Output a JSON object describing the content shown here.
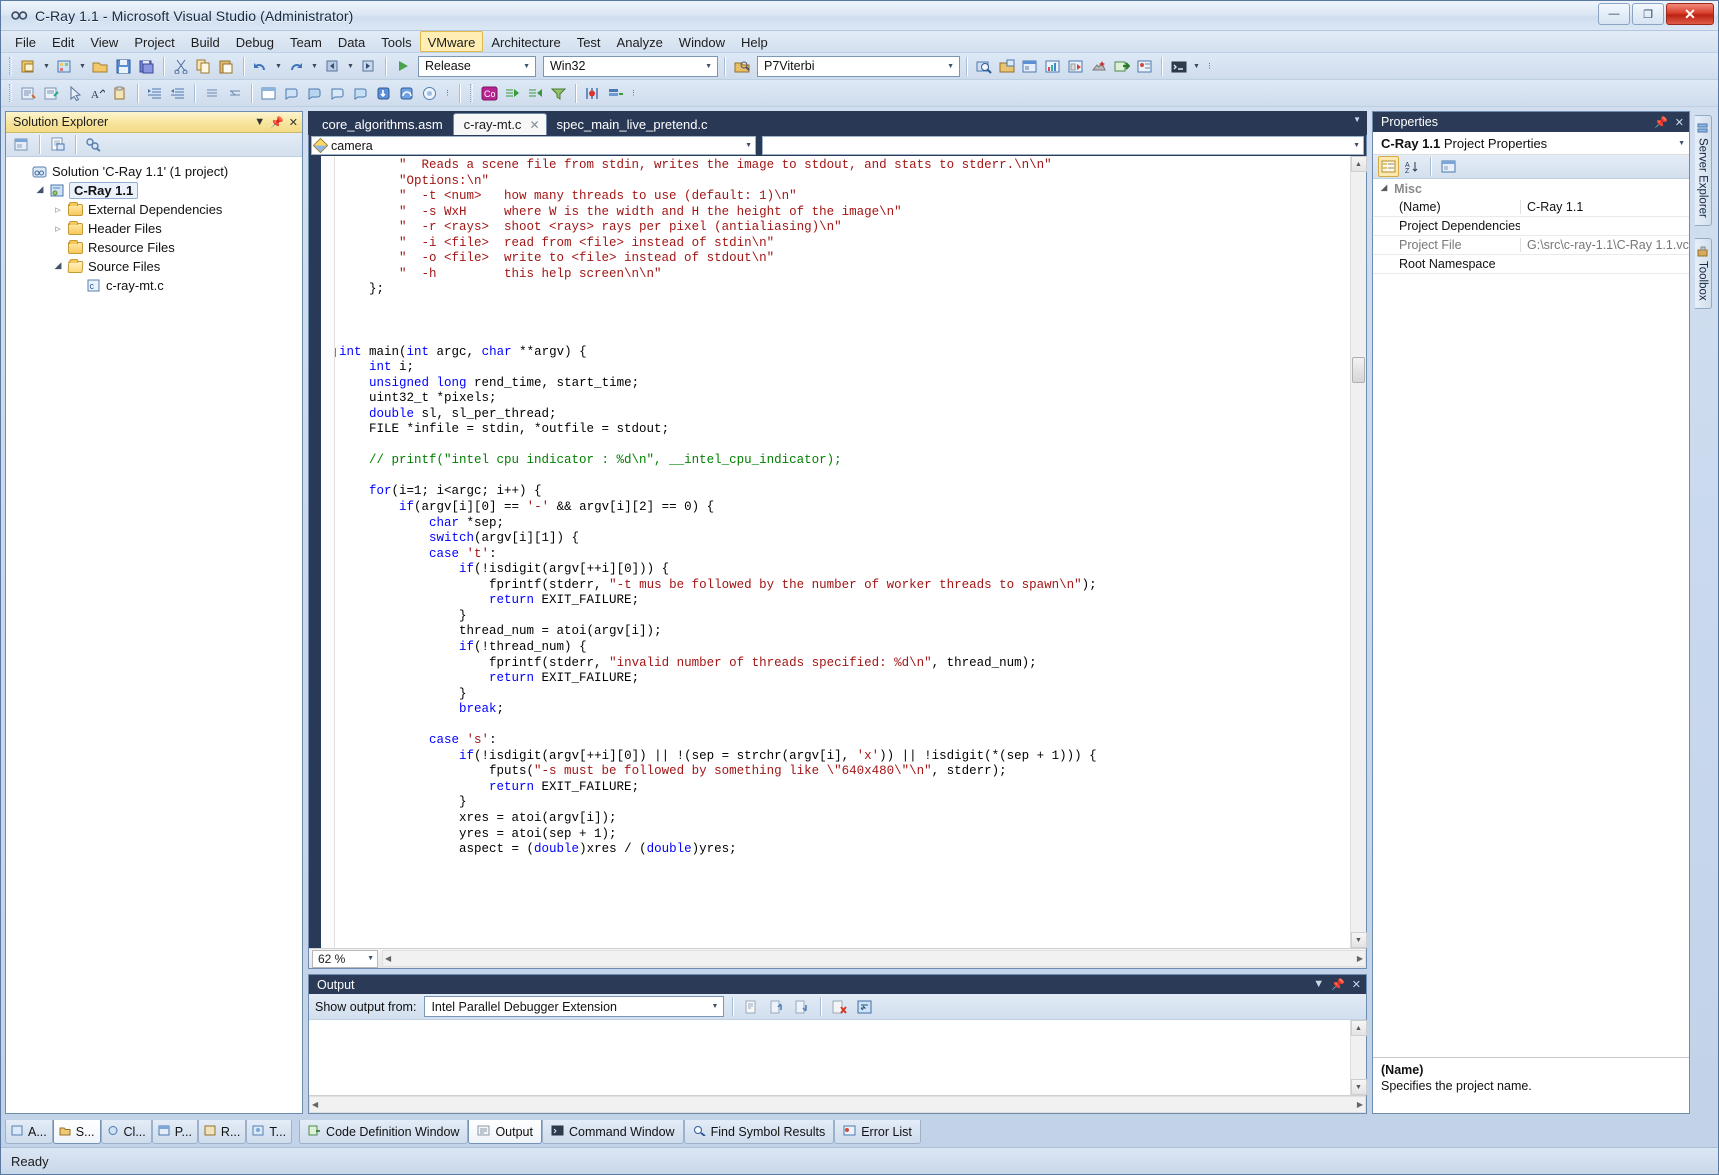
{
  "window": {
    "title": "C-Ray 1.1 - Microsoft Visual Studio (Administrator)",
    "app_icon": "visual-studio-infinity-icon",
    "minimize": "—",
    "maximize": "❐",
    "close": "✕"
  },
  "menu": {
    "items": [
      {
        "label": "File"
      },
      {
        "label": "Edit"
      },
      {
        "label": "View"
      },
      {
        "label": "Project"
      },
      {
        "label": "Build"
      },
      {
        "label": "Debug"
      },
      {
        "label": "Team"
      },
      {
        "label": "Data"
      },
      {
        "label": "Tools"
      },
      {
        "label": "VMware",
        "highlighted": true
      },
      {
        "label": "Architecture"
      },
      {
        "label": "Test"
      },
      {
        "label": "Analyze"
      },
      {
        "label": "Window"
      },
      {
        "label": "Help"
      }
    ]
  },
  "toolbar_standard": {
    "config_combo": "Release",
    "platform_combo": "Win32",
    "symbol_combo": "P7Viterbi",
    "icons": [
      "new-project-icon",
      "add-new-item-icon",
      "open-file-icon",
      "save-icon",
      "save-all-icon",
      "cut-icon",
      "copy-icon",
      "paste-icon",
      "undo-icon",
      "redo-icon",
      "navigate-backward-icon",
      "navigate-forward-icon",
      "start-debugging-icon",
      "find-in-files-icon",
      "solution-explorer-icon",
      "properties-window-icon",
      "object-browser-icon",
      "toolbox-icon",
      "extension-manager-icon",
      "code-definition-icon",
      "error-list-icon",
      "command-window-icon"
    ]
  },
  "toolbar_secondary": {
    "icons": [
      "comment-selection-icon",
      "uncomment-selection-icon",
      "pointer-icon",
      "increase-font-icon",
      "clipboard-ring-icon",
      "indent-icon",
      "outdent-icon",
      "expand-all-icon",
      "collapse-all-icon",
      "breakpoint-window-icon",
      "quick-watch-icon",
      "watch-icon",
      "autos-icon",
      "locals-icon",
      "step-into-icon",
      "step-over-icon",
      "step-out-icon",
      "amplifier-icon",
      "start-analysis-icon",
      "parallel-tasks-icon",
      "thread-icon",
      "data-breakpoint-icon",
      "serialize-icon",
      "filter-icon",
      "parallel-stacks-icon",
      "thread-list-icon"
    ]
  },
  "solution_explorer": {
    "title": "Solution Explorer",
    "pin_icon": "pin-icon",
    "close_icon": "close-icon",
    "dropdown_icon": "chevron-down-icon",
    "toolbar_icons": [
      "properties-icon",
      "show-all-files-icon",
      "view-class-diagram-icon"
    ],
    "tree": [
      {
        "label": "Solution 'C-Ray 1.1' (1 project)",
        "indent": 0,
        "twisty": "none",
        "icon": "solution-icon",
        "selected": false
      },
      {
        "label": "C-Ray 1.1",
        "indent": 1,
        "twisty": "open",
        "icon": "cpp-project-icon",
        "selected": true
      },
      {
        "label": "External Dependencies",
        "indent": 2,
        "twisty": "closed",
        "icon": "dependencies-folder-icon",
        "selected": false
      },
      {
        "label": "Header Files",
        "indent": 2,
        "twisty": "closed",
        "icon": "folder-icon",
        "selected": false
      },
      {
        "label": "Resource Files",
        "indent": 2,
        "twisty": "none",
        "icon": "folder-icon",
        "selected": false
      },
      {
        "label": "Source Files",
        "indent": 2,
        "twisty": "open",
        "icon": "folder-open-icon",
        "selected": false
      },
      {
        "label": "c-ray-mt.c",
        "indent": 3,
        "twisty": "none",
        "icon": "c-file-icon",
        "selected": false
      }
    ]
  },
  "editor": {
    "tabs": [
      {
        "label": "core_algorithms.asm",
        "active": false,
        "closable": false
      },
      {
        "label": "c-ray-mt.c",
        "active": true,
        "closable": true
      },
      {
        "label": "spec_main_live_pretend.c",
        "active": false,
        "closable": false
      }
    ],
    "tab_close_glyph": "✕",
    "tabstrip_dropdown": "▼",
    "nav_scope": "camera",
    "nav_member": "",
    "nav_scope_icon": "namespace-diamond-icon",
    "zoom_level": "62 %",
    "code_lines": [
      {
        "indent": 8,
        "segments": [
          {
            "t": "\"  Reads a scene file from stdin, writes the image to stdout, and stats to stderr.\\n\\n\"",
            "c": "str"
          }
        ]
      },
      {
        "indent": 8,
        "segments": [
          {
            "t": "\"Options:\\n\"",
            "c": "str"
          }
        ]
      },
      {
        "indent": 8,
        "segments": [
          {
            "t": "\"  -t <num>   how many threads to use (default: 1)\\n\"",
            "c": "str"
          }
        ]
      },
      {
        "indent": 8,
        "segments": [
          {
            "t": "\"  -s WxH     where W is the width and H the height of the image\\n\"",
            "c": "str"
          }
        ]
      },
      {
        "indent": 8,
        "segments": [
          {
            "t": "\"  -r <rays>  shoot <rays> rays per pixel (antialiasing)\\n\"",
            "c": "str"
          }
        ]
      },
      {
        "indent": 8,
        "segments": [
          {
            "t": "\"  -i <file>  read from <file> instead of stdin\\n\"",
            "c": "str"
          }
        ]
      },
      {
        "indent": 8,
        "segments": [
          {
            "t": "\"  -o <file>  write to <file> instead of stdout\\n\"",
            "c": "str"
          }
        ]
      },
      {
        "indent": 8,
        "segments": [
          {
            "t": "\"  -h         this help screen\\n\\n\"",
            "c": "str"
          }
        ]
      },
      {
        "indent": 4,
        "segments": [
          {
            "t": "};",
            "c": ""
          }
        ]
      },
      {
        "indent": 0,
        "segments": []
      },
      {
        "indent": 0,
        "segments": []
      },
      {
        "indent": 0,
        "segments": []
      },
      {
        "indent": 0,
        "fold": true,
        "segments": [
          {
            "t": "int",
            "c": "kw"
          },
          {
            "t": " main(",
            "c": ""
          },
          {
            "t": "int",
            "c": "kw"
          },
          {
            "t": " argc, ",
            "c": ""
          },
          {
            "t": "char",
            "c": "kw"
          },
          {
            "t": " **argv) {",
            "c": ""
          }
        ]
      },
      {
        "indent": 4,
        "segments": [
          {
            "t": "int",
            "c": "kw"
          },
          {
            "t": " i;",
            "c": ""
          }
        ]
      },
      {
        "indent": 4,
        "segments": [
          {
            "t": "unsigned long",
            "c": "kw"
          },
          {
            "t": " rend_time, start_time;",
            "c": ""
          }
        ]
      },
      {
        "indent": 4,
        "segments": [
          {
            "t": "uint32_t *pixels;",
            "c": ""
          }
        ]
      },
      {
        "indent": 4,
        "segments": [
          {
            "t": "double",
            "c": "kw"
          },
          {
            "t": " sl, sl_per_thread;",
            "c": ""
          }
        ]
      },
      {
        "indent": 4,
        "segments": [
          {
            "t": "FILE *infile = stdin, *outfile = stdout;",
            "c": ""
          }
        ]
      },
      {
        "indent": 0,
        "segments": []
      },
      {
        "indent": 4,
        "segments": [
          {
            "t": "// printf(\"intel cpu indicator : %d\\n\", __intel_cpu_indicator);",
            "c": "cmt"
          }
        ]
      },
      {
        "indent": 0,
        "segments": []
      },
      {
        "indent": 4,
        "segments": [
          {
            "t": "for",
            "c": "kw"
          },
          {
            "t": "(i=1; i<argc; i++) {",
            "c": ""
          }
        ]
      },
      {
        "indent": 8,
        "segments": [
          {
            "t": "if",
            "c": "kw"
          },
          {
            "t": "(argv[i][0] == ",
            "c": ""
          },
          {
            "t": "'-'",
            "c": "chr"
          },
          {
            "t": " && argv[i][2] == 0) {",
            "c": ""
          }
        ]
      },
      {
        "indent": 12,
        "segments": [
          {
            "t": "char",
            "c": "kw"
          },
          {
            "t": " *sep;",
            "c": ""
          }
        ]
      },
      {
        "indent": 12,
        "segments": [
          {
            "t": "switch",
            "c": "kw"
          },
          {
            "t": "(argv[i][1]) {",
            "c": ""
          }
        ]
      },
      {
        "indent": 12,
        "segments": [
          {
            "t": "case",
            "c": "kw"
          },
          {
            "t": " ",
            "c": ""
          },
          {
            "t": "'t'",
            "c": "chr"
          },
          {
            "t": ":",
            "c": ""
          }
        ]
      },
      {
        "indent": 16,
        "segments": [
          {
            "t": "if",
            "c": "kw"
          },
          {
            "t": "(!isdigit(argv[++i][0])) {",
            "c": ""
          }
        ]
      },
      {
        "indent": 20,
        "segments": [
          {
            "t": "fprintf(stderr, ",
            "c": ""
          },
          {
            "t": "\"-t mus be followed by the number of worker threads to spawn\\n\"",
            "c": "str"
          },
          {
            "t": ");",
            "c": ""
          }
        ]
      },
      {
        "indent": 20,
        "segments": [
          {
            "t": "return",
            "c": "kw"
          },
          {
            "t": " EXIT_FAILURE;",
            "c": ""
          }
        ]
      },
      {
        "indent": 16,
        "segments": [
          {
            "t": "}",
            "c": ""
          }
        ]
      },
      {
        "indent": 16,
        "segments": [
          {
            "t": "thread_num = atoi(argv[i]);",
            "c": ""
          }
        ]
      },
      {
        "indent": 16,
        "segments": [
          {
            "t": "if",
            "c": "kw"
          },
          {
            "t": "(!thread_num) {",
            "c": ""
          }
        ]
      },
      {
        "indent": 20,
        "segments": [
          {
            "t": "fprintf(stderr, ",
            "c": ""
          },
          {
            "t": "\"invalid number of threads specified: %d\\n\"",
            "c": "str"
          },
          {
            "t": ", thread_num);",
            "c": ""
          }
        ]
      },
      {
        "indent": 20,
        "segments": [
          {
            "t": "return",
            "c": "kw"
          },
          {
            "t": " EXIT_FAILURE;",
            "c": ""
          }
        ]
      },
      {
        "indent": 16,
        "segments": [
          {
            "t": "}",
            "c": ""
          }
        ]
      },
      {
        "indent": 16,
        "segments": [
          {
            "t": "break",
            "c": "kw"
          },
          {
            "t": ";",
            "c": ""
          }
        ]
      },
      {
        "indent": 0,
        "segments": []
      },
      {
        "indent": 12,
        "segments": [
          {
            "t": "case",
            "c": "kw"
          },
          {
            "t": " ",
            "c": ""
          },
          {
            "t": "'s'",
            "c": "chr"
          },
          {
            "t": ":",
            "c": ""
          }
        ]
      },
      {
        "indent": 16,
        "segments": [
          {
            "t": "if",
            "c": "kw"
          },
          {
            "t": "(!isdigit(argv[++i][0]) || !(sep = strchr(argv[i], ",
            "c": ""
          },
          {
            "t": "'x'",
            "c": "chr"
          },
          {
            "t": ")) || !isdigit(*(sep + 1))) {",
            "c": ""
          }
        ]
      },
      {
        "indent": 20,
        "segments": [
          {
            "t": "fputs(",
            "c": ""
          },
          {
            "t": "\"-s must be followed by something like \\\"640x480\\\"\\n\"",
            "c": "str"
          },
          {
            "t": ", stderr);",
            "c": ""
          }
        ]
      },
      {
        "indent": 20,
        "segments": [
          {
            "t": "return",
            "c": "kw"
          },
          {
            "t": " EXIT_FAILURE;",
            "c": ""
          }
        ]
      },
      {
        "indent": 16,
        "segments": [
          {
            "t": "}",
            "c": ""
          }
        ]
      },
      {
        "indent": 16,
        "segments": [
          {
            "t": "xres = atoi(argv[i]);",
            "c": ""
          }
        ]
      },
      {
        "indent": 16,
        "segments": [
          {
            "t": "yres = atoi(sep + 1);",
            "c": ""
          }
        ]
      },
      {
        "indent": 16,
        "segments": [
          {
            "t": "aspect = (",
            "c": ""
          },
          {
            "t": "double",
            "c": "kw"
          },
          {
            "t": ")xres / (",
            "c": ""
          },
          {
            "t": "double",
            "c": "kw"
          },
          {
            "t": ")yres;",
            "c": ""
          }
        ]
      }
    ]
  },
  "output": {
    "title": "Output",
    "label_show_output_from": "Show output from:",
    "selected_source": "Intel Parallel Debugger Extension",
    "body_text": "",
    "toolbar_icons": [
      "find-message-icon",
      "go-to-previous-icon",
      "go-to-next-icon",
      "clear-all-icon",
      "toggle-word-wrap-icon"
    ],
    "head_icons": [
      "chevron-down-icon",
      "pin-icon",
      "close-icon"
    ]
  },
  "properties": {
    "title": "Properties",
    "subtitle_bold": "C-Ray 1.1",
    "subtitle_rest": " Project Properties",
    "dropdown_icon": "chevron-down-icon",
    "toolbar_icons": [
      "categorized-icon",
      "alphabetical-icon",
      "property-pages-icon"
    ],
    "category": "Misc",
    "rows": [
      {
        "name": "(Name)",
        "value": "C-Ray 1.1",
        "name_dim": false,
        "value_dim": false
      },
      {
        "name": "Project Dependencies",
        "value": "",
        "name_dim": false,
        "value_dim": false
      },
      {
        "name": "Project File",
        "value": "G:\\src\\c-ray-1.1\\C-Ray 1.1.vcxproj",
        "name_dim": true,
        "value_dim": true
      },
      {
        "name": "Root Namespace",
        "value": "",
        "name_dim": false,
        "value_dim": false
      }
    ],
    "description_title": "(Name)",
    "description_text": "Specifies the project name.",
    "head_icons": [
      "pin-icon",
      "close-icon"
    ]
  },
  "right_rail": {
    "tabs": [
      {
        "label": "Server Explorer",
        "icon": "server-explorer-icon"
      },
      {
        "label": "Toolbox",
        "icon": "toolbox-icon"
      }
    ]
  },
  "bottom_tabs": {
    "left_group": [
      {
        "label": "A...",
        "icon": "autos-icon",
        "active": false
      },
      {
        "label": "S...",
        "icon": "solution-explorer-icon",
        "active": true
      },
      {
        "label": "Cl...",
        "icon": "class-view-icon",
        "active": false
      },
      {
        "label": "P...",
        "icon": "properties-icon",
        "active": false
      },
      {
        "label": "R...",
        "icon": "resource-view-icon",
        "active": false
      },
      {
        "label": "T...",
        "icon": "team-explorer-icon",
        "active": false
      }
    ],
    "right_group": [
      {
        "label": "Code Definition Window",
        "icon": "code-definition-icon",
        "active": false
      },
      {
        "label": "Output",
        "icon": "output-icon",
        "active": true
      },
      {
        "label": "Command Window",
        "icon": "command-window-icon",
        "active": false
      },
      {
        "label": "Find Symbol Results",
        "icon": "find-symbol-icon",
        "active": false
      },
      {
        "label": "Error List",
        "icon": "error-list-icon",
        "active": false
      }
    ]
  },
  "status": {
    "text": "Ready"
  },
  "colors": {
    "accent_titlebar": "#2b3b57",
    "panel_header": "#f8e6a0",
    "keyword": "#0000ff",
    "string": "#a31515",
    "comment": "#008000",
    "close_button": "#d8402c"
  }
}
